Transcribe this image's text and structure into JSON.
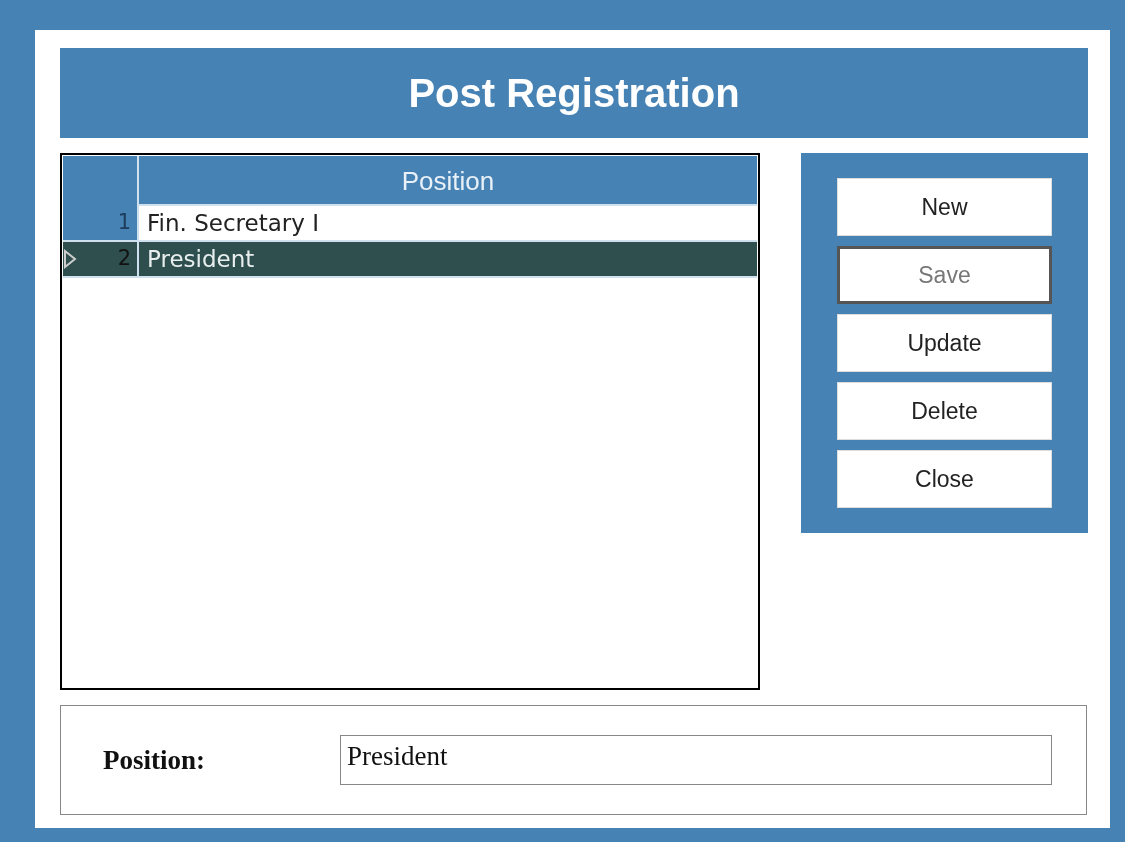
{
  "window": {
    "title": "Post Registration"
  },
  "grid": {
    "columns": [
      "Position"
    ],
    "rows": [
      {
        "number": "1",
        "position": "Fin. Secretary I",
        "selected": false
      },
      {
        "number": "2",
        "position": "President",
        "selected": true
      }
    ]
  },
  "buttons": [
    {
      "label": "New",
      "disabled": false
    },
    {
      "label": "Save",
      "disabled": true
    },
    {
      "label": "Update",
      "disabled": false
    },
    {
      "label": "Delete",
      "disabled": false
    },
    {
      "label": "Close",
      "disabled": false
    }
  ],
  "form": {
    "label": "Position:",
    "value": "President"
  }
}
